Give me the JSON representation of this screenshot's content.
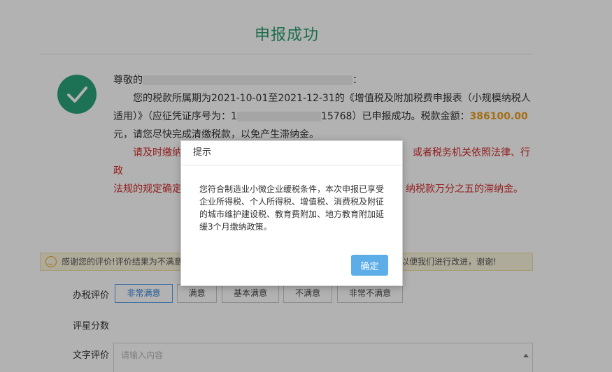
{
  "page": {
    "title": "申报成功"
  },
  "message": {
    "greeting_prefix": "尊敬的",
    "greeting_suffix": "：",
    "line_part1": "您的税款所属期为2021-10-01至2021-12-31的《增值税及附加税费申报表（小规模纳税人适用）》（应征凭证序号为：1",
    "voucher_tail": "15768",
    "line_part2": "）已申报成功。税款金额：",
    "amount": "386100.00",
    "line_part3": "元，请您尽快完成清缴税款，以免产生滞纳金。",
    "warning_start": "请及时缴纳",
    "warning_middle_right": "或者税务机关依照法律、行政",
    "warning_line2_start": "法规的规定确定",
    "warning_line2_end": "纳税款万分之五的滞纳金。"
  },
  "rating": {
    "notice_left": "感谢您的评价!评价结果为不满意",
    "notice_right": "以便我们进行改进，谢谢!",
    "label_evaluation": "办税评价",
    "options": [
      "非常满意",
      "满意",
      "基本满意",
      "不满意",
      "非常不满意"
    ],
    "selected": "非常满意",
    "label_score": "评星分数",
    "label_text": "文字评价",
    "text_placeholder": "请输入内容"
  },
  "dialog": {
    "title": "提示",
    "body": "您符合制造业小微企业缓税条件，本次申报已享受企业所得税、个人所得税、增值税、消费税及附征的城市维护建设税、教育费附加、地方教育附加延缓3个月缴纳政策。",
    "ok_label": "确定"
  },
  "colors": {
    "title_green": "#2a9d6f",
    "check_green": "#2aa37a",
    "amount_orange": "#e8a024",
    "warning_red": "#d22c2c",
    "button_blue": "#5dade8"
  },
  "icons": {
    "success": "check-icon",
    "smile": "smile-icon"
  }
}
